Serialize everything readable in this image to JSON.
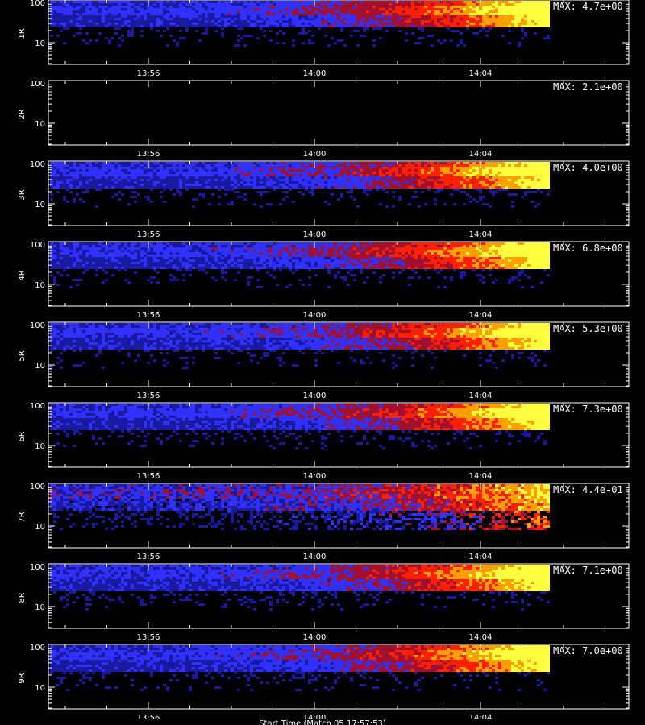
{
  "chart_data": {
    "type": "heatmap",
    "x_ticks": [
      "13:56",
      "14:00",
      "14:04"
    ],
    "y_ticks": [
      "10",
      "100"
    ],
    "y_scale": "log",
    "x_axis_label": "Start Time (Match 05 17:57:53)",
    "colormap": [
      "#000000",
      "#1a1aa0",
      "#3030ff",
      "#a01030",
      "#ff2000",
      "#ffa000",
      "#ffff40"
    ],
    "panels": [
      {
        "label": "1R",
        "max_text": "MAX: 4.7e+00",
        "max": 4.7,
        "has_data": true
      },
      {
        "label": "2R",
        "max_text": "MAX: 2.1e+00",
        "max": 2.1,
        "has_data": false
      },
      {
        "label": "3R",
        "max_text": "MAX: 4.0e+00",
        "max": 4.0,
        "has_data": true
      },
      {
        "label": "4R",
        "max_text": "MAX: 6.8e+00",
        "max": 6.8,
        "has_data": true
      },
      {
        "label": "5R",
        "max_text": "MAX: 5.3e+00",
        "max": 5.3,
        "has_data": true
      },
      {
        "label": "6R",
        "max_text": "MAX: 7.3e+00",
        "max": 7.3,
        "has_data": true
      },
      {
        "label": "7R",
        "max_text": "MAX: 4.4e-01",
        "max": 0.44,
        "has_data": true
      },
      {
        "label": "8R",
        "max_text": "MAX: 7.1e+00",
        "max": 7.1,
        "has_data": true
      },
      {
        "label": "9R",
        "max_text": "MAX: 7.0e+00",
        "max": 7.0,
        "has_data": true
      }
    ]
  }
}
